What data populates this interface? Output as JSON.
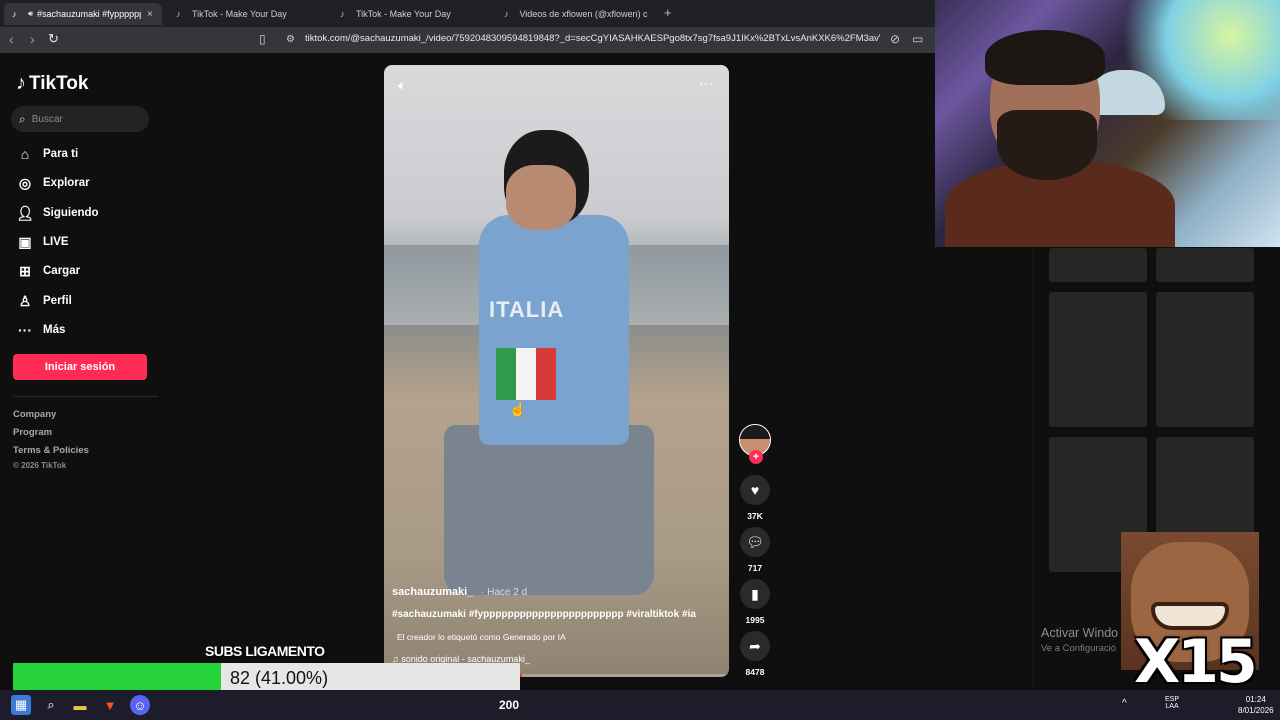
{
  "browser": {
    "tabs": [
      {
        "title": "#sachauzumaki #fyppppppp",
        "active": true
      },
      {
        "title": "TikTok - Make Your Day",
        "active": false
      },
      {
        "title": "TikTok - Make Your Day",
        "active": false
      },
      {
        "title": "Videos de xflowen (@xflowen) con \"s",
        "active": false
      }
    ],
    "url": "tiktok.com/@sachauzumaki_/video/7592048309594819848?_d=secCgYIASAHKAESPgo8tx7sg7fsa9J1IKx%2BTxLvsAnKXK6%2FM3avVJIErPC..."
  },
  "sidebar": {
    "logo": "TikTok",
    "search_placeholder": "Buscar",
    "items": [
      {
        "label": "Para ti",
        "icon": "home-icon"
      },
      {
        "label": "Explorar",
        "icon": "compass-icon"
      },
      {
        "label": "Siguiendo",
        "icon": "following-icon"
      },
      {
        "label": "LIVE",
        "icon": "live-icon"
      },
      {
        "label": "Cargar",
        "icon": "upload-icon"
      },
      {
        "label": "Perfil",
        "icon": "profile-icon"
      },
      {
        "label": "Más",
        "icon": "more-icon"
      }
    ],
    "login_button": "Iniciar sesión",
    "footer": [
      "Company",
      "Program",
      "Terms & Policies"
    ],
    "copyright": "© 2026 TikTok"
  },
  "video": {
    "shirt_text": "ITALIA",
    "author": "sachauzumaki_",
    "when": "· Hace 2 d",
    "hashtags": "#sachauzumaki #fyppppppppppppppppppppppp #viraltiktok #ia",
    "ai_label": "El creador lo etiquetó como Generado por IA",
    "sound": "♫ sonido original - sachauzumaki_",
    "progress": 0.4
  },
  "actions": {
    "likes": "37K",
    "comments": "717",
    "saves": "1995",
    "shares": "8478"
  },
  "windows_watermark": {
    "line1": "Activar Windo",
    "line2": "Ve a Configuració"
  },
  "overlay": {
    "meme_label": "X15",
    "subs_label": "SUBS LIGAMENTO",
    "subs_text": "82 (41.00%)",
    "subs_fraction": 0.41
  },
  "taskbar": {
    "center_count": "200",
    "lang": "ESP\nLAA",
    "time": "01:24",
    "date": "8/01/2026"
  },
  "colors": {
    "accent": "#fe2c55",
    "subs_fill": "#27d33a",
    "background": "#0f0f0f"
  }
}
